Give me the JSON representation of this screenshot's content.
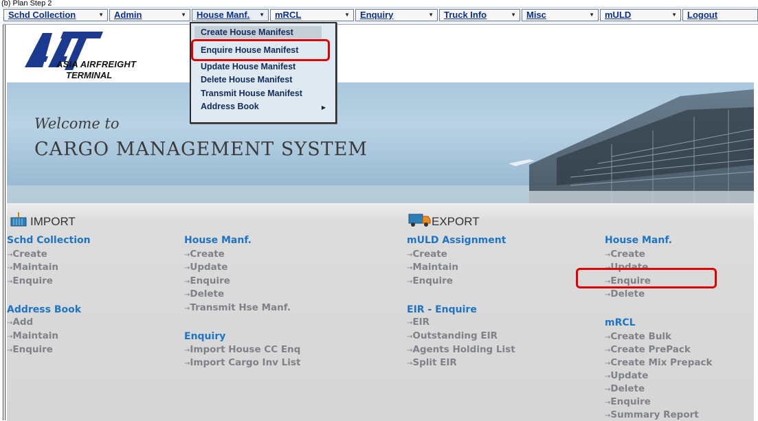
{
  "caption": "(b) Plan Step 2",
  "menubar": {
    "items": [
      {
        "label": "Schd Collection"
      },
      {
        "label": "Admin"
      },
      {
        "label": "House Manf."
      },
      {
        "label": "mRCL"
      },
      {
        "label": "Enquiry"
      },
      {
        "label": "Truck Info"
      },
      {
        "label": "Misc"
      },
      {
        "label": "mULD"
      },
      {
        "label": "Logout"
      }
    ]
  },
  "dropdown": {
    "items": [
      {
        "label": "Create House Manifest"
      },
      {
        "label": "Enquire House Manifest"
      },
      {
        "label": "Update House Manifest"
      },
      {
        "label": "Delete House Manifest"
      },
      {
        "label": "Transmit House Manifest"
      },
      {
        "label": "Address Book"
      }
    ]
  },
  "logo": {
    "line1": "ASIA AIRFREIGHT",
    "line2": "TERMINAL",
    "brand_color": "#1b3a8f"
  },
  "banner": {
    "welcome": "Welcome to",
    "title": "CARGO MANAGEMENT SYSTEM"
  },
  "import": {
    "title": "IMPORT",
    "schd": {
      "head": "Schd Collection",
      "links": [
        "Create",
        "Maintain",
        "Enquire"
      ]
    },
    "address": {
      "head": "Address Book",
      "links": [
        "Add",
        "Maintain",
        "Enquire"
      ]
    },
    "house": {
      "head": "House Manf.",
      "links": [
        "Create",
        "Update",
        "Enquire",
        "Delete",
        "Transmit Hse Manf."
      ]
    },
    "enquiry": {
      "head": "Enquiry",
      "links": [
        "Import House CC Enq",
        "Import Cargo Inv List"
      ]
    }
  },
  "export": {
    "title": "EXPORT",
    "muld": {
      "head": "mULD Assignment",
      "links": [
        "Create",
        "Maintain",
        "Enquire"
      ]
    },
    "eir": {
      "head": "EIR - Enquire",
      "links": [
        "EIR",
        "Outstanding EIR",
        "Agents Holding List",
        "Split EIR"
      ]
    },
    "house": {
      "head": "House Manf.",
      "links": [
        "Create",
        "Update",
        "Enquire",
        "Delete"
      ]
    },
    "mrcl": {
      "head": "mRCL",
      "links": [
        "Create Bulk",
        "Create PrePack",
        "Create Mix Prepack",
        "Update",
        "Delete",
        "Enquire",
        "Summary Report"
      ]
    }
  },
  "colors": {
    "link_head": "#1d74c7",
    "highlight": "#e00000",
    "menu_text": "#0a2f8f"
  }
}
